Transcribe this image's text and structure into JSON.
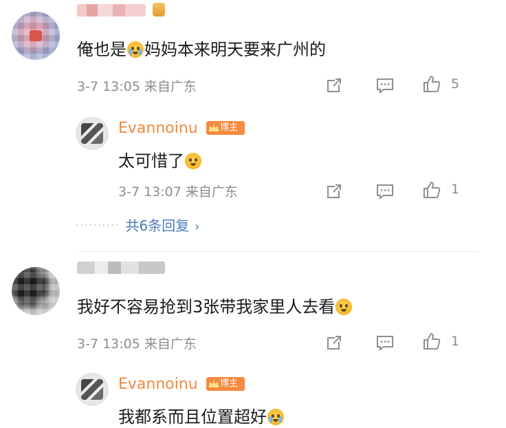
{
  "comments": [
    {
      "text": "俺也是😭妈妈本来明天要来广州的",
      "text_before": "俺也是",
      "text_after": "妈妈本来明天要来广州的",
      "time": "3-7 13:05",
      "location": "来自广东",
      "likes": "5",
      "reply": {
        "username": "Evannoinu",
        "badge": "博主",
        "text": "太可惜了",
        "time": "3-7 13:07",
        "location": "来自广东",
        "likes": "1"
      },
      "more_replies": "共6条回复"
    },
    {
      "text": "我好不容易抢到3张带我家里人去看",
      "time": "3-7 13:05",
      "location": "来自广东",
      "likes": "1",
      "reply": {
        "username": "Evannoinu",
        "badge": "博主",
        "text": "我都系而且位置超好"
      }
    }
  ],
  "icons": {
    "share": "share-icon",
    "comment": "comment-icon",
    "like": "thumbs-up-icon",
    "crown": "crown-icon",
    "emoji": "emoji-icon"
  },
  "colors": {
    "username": "#f08a3f",
    "badge": "#f48a3f",
    "link": "#4a7bb8",
    "meta": "#8c8c8c"
  }
}
